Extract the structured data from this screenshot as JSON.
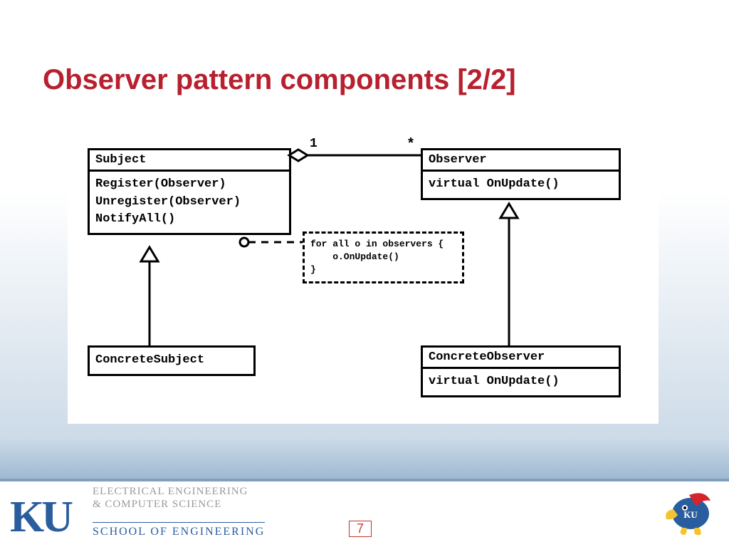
{
  "title": "Observer pattern components [2/2]",
  "diagram": {
    "subject": {
      "name": "Subject",
      "methods": [
        "Register(Observer)",
        "Unregister(Observer)",
        "NotifyAll()"
      ]
    },
    "observer": {
      "name": "Observer",
      "methods": [
        "virtual OnUpdate()"
      ]
    },
    "concreteSubject": {
      "name": "ConcreteSubject"
    },
    "concreteObserver": {
      "name": "ConcreteObserver",
      "methods": [
        "virtual OnUpdate()"
      ]
    },
    "note": {
      "line1": "for all o in observers {",
      "line2": "    o.OnUpdate()",
      "line3": "}"
    },
    "multiplicity": {
      "left": "1",
      "right": "*"
    }
  },
  "footer": {
    "ku": "KU",
    "dept_line1": "ELECTRICAL ENGINEERING",
    "dept_line2": "& COMPUTER SCIENCE",
    "school": "SCHOOL OF ENGINEERING",
    "page": "7"
  }
}
